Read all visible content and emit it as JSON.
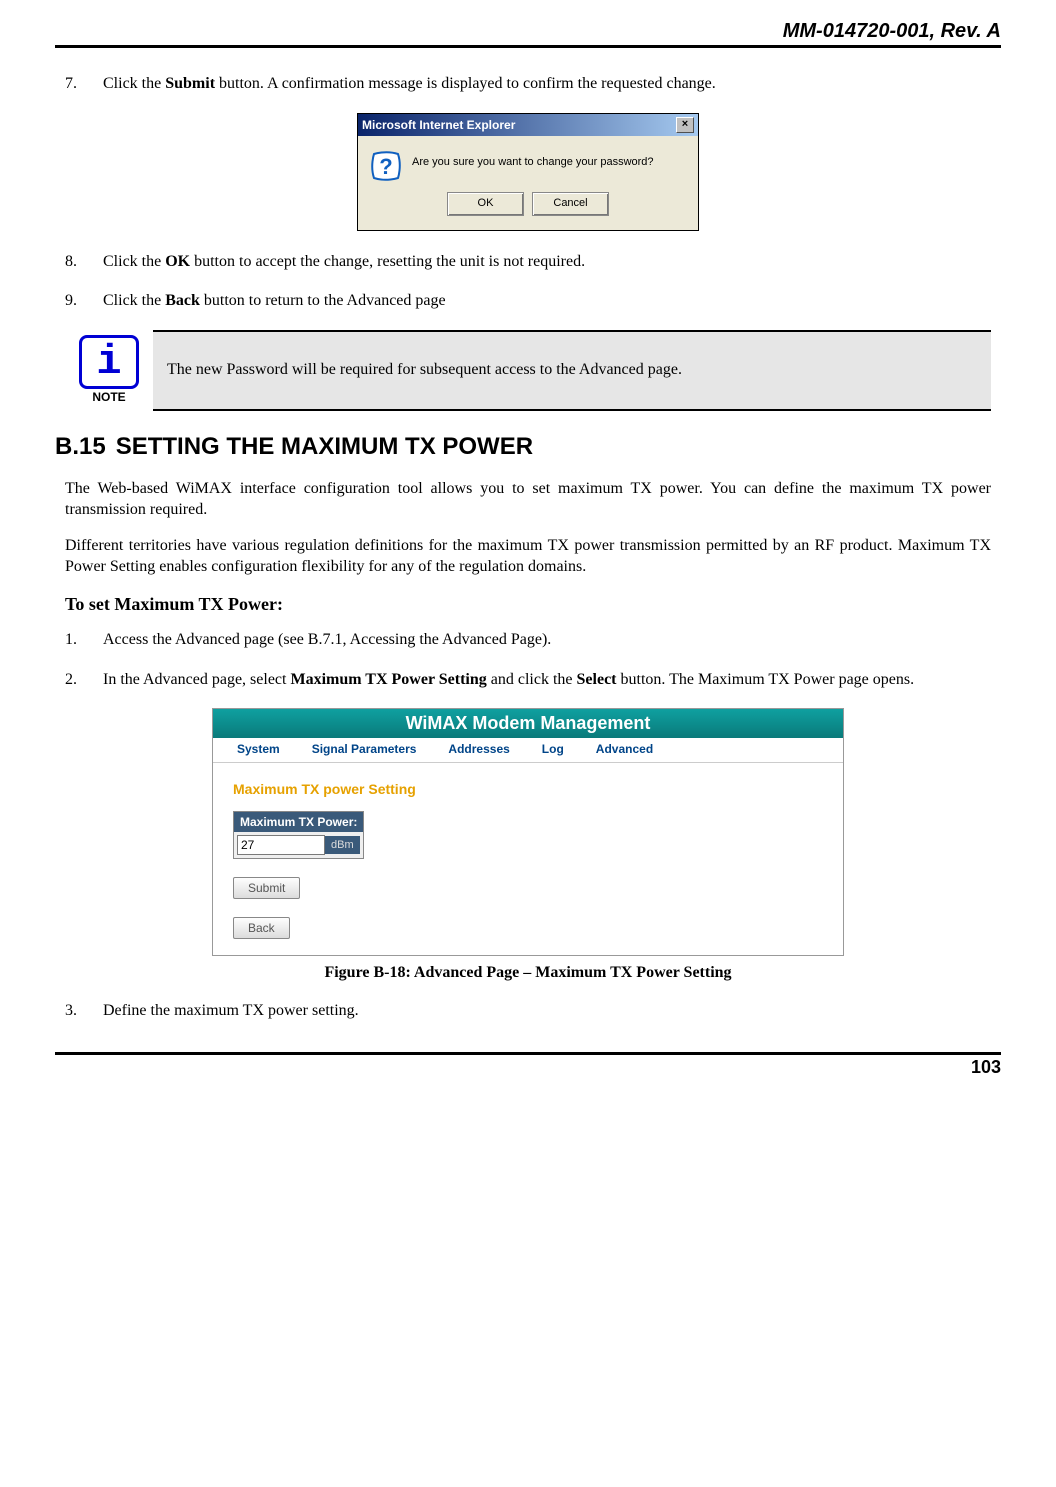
{
  "header": {
    "doc_id": "MM-014720-001, Rev. A"
  },
  "steps_a": {
    "item7": {
      "num": "7.",
      "pre": "Click the ",
      "b": "Submit",
      "post": " button.  A confirmation message is displayed to confirm the requested change."
    },
    "item8": {
      "num": "8.",
      "pre": "Click the ",
      "b": "OK",
      "post": " button to accept the change, resetting the unit is not required."
    },
    "item9": {
      "num": "9.",
      "pre": "Click the ",
      "b": "Back",
      "post": " button to return to the Advanced page"
    }
  },
  "dialog": {
    "title": "Microsoft Internet Explorer",
    "message": "Are you sure you want to change your password?",
    "ok": "OK",
    "cancel": "Cancel"
  },
  "note": {
    "label": "NOTE",
    "text": "The new Password will be required for subsequent access to the Advanced page."
  },
  "section": {
    "num": "B.15",
    "title": "SETTING THE MAXIMUM TX POWER"
  },
  "para1": "The Web-based WiMAX interface configuration tool allows you to set maximum TX power.  You can define the maximum TX power transmission required.",
  "para2": "Different territories have various regulation definitions for the maximum TX power transmission permitted by an RF product.  Maximum TX Power Setting enables configuration flexibility for any of the regulation domains.",
  "subheader": "To set Maximum TX Power:",
  "steps_b": {
    "item1": {
      "num": "1.",
      "text": "Access the Advanced page (see B.7.1, Accessing the Advanced Page)."
    },
    "item2": {
      "num": "2.",
      "pre": "In the Advanced page, select ",
      "b1": "Maximum TX Power Setting",
      "mid": " and click the ",
      "b2": "Select",
      "post": " button.   The Maximum TX Power page opens."
    },
    "item3": {
      "num": "3.",
      "text": "Define the maximum TX power setting."
    }
  },
  "screenshot": {
    "title": "WiMAX Modem Management",
    "nav": {
      "n1": "System",
      "n2": "Signal Parameters",
      "n3": "Addresses",
      "n4": "Log",
      "n5": "Advanced"
    },
    "heading": "Maximum TX power Setting",
    "field_label": "Maximum TX Power:",
    "field_value": "27",
    "field_unit": "dBm",
    "submit": "Submit",
    "back": "Back"
  },
  "figure_caption": "Figure B-18:  Advanced Page – Maximum TX Power Setting",
  "footer": {
    "page_num": "103"
  }
}
